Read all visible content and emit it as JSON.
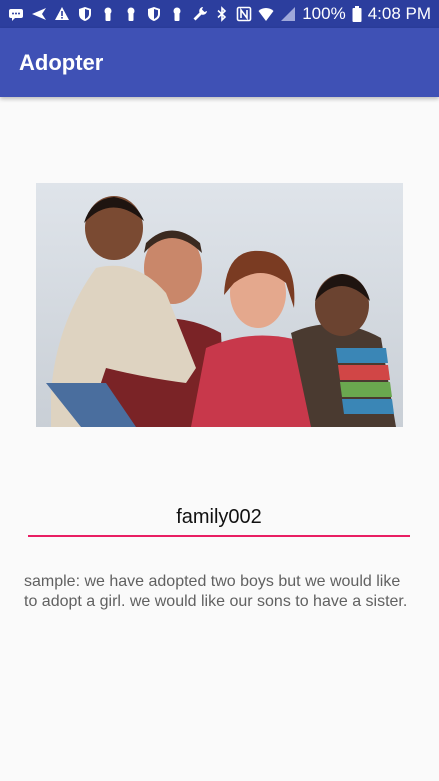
{
  "status_bar": {
    "battery": "100%",
    "time": "4:08 PM",
    "icons": [
      "message-icon",
      "send-icon",
      "warning-icon",
      "shield-icon",
      "keyhole-icon",
      "keyhole-icon",
      "shield-icon",
      "keyhole-icon",
      "wrench-icon",
      "bluetooth-icon",
      "nfc-icon",
      "wifi-icon",
      "signal-icon",
      "battery-icon"
    ]
  },
  "app_bar": {
    "title": "Adopter"
  },
  "profile": {
    "name": "family002",
    "description": "sample:  we have adopted two boys but we would like to adopt a girl.  we would like our sons to have a sister."
  },
  "colors": {
    "status_bar": "#2c3e9e",
    "app_bar": "#3f51b5",
    "accent_underline": "#e91e63",
    "background": "#fafafa"
  }
}
